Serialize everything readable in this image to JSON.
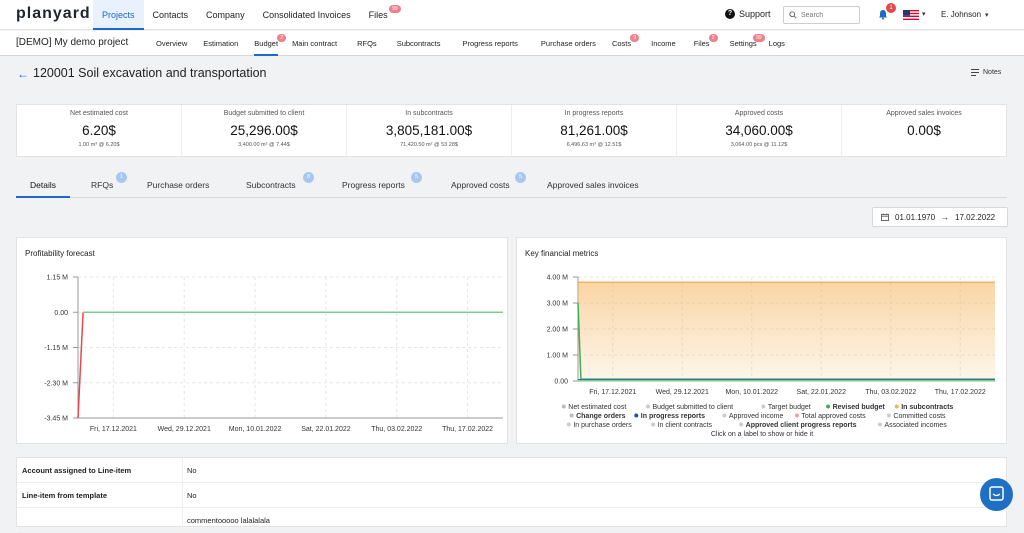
{
  "brand": "planyard",
  "topnav": [
    {
      "label": "Projects",
      "active": true
    },
    {
      "label": "Contacts"
    },
    {
      "label": "Company"
    },
    {
      "label": "Consolidated Invoices"
    },
    {
      "label": "Files",
      "badge": "99"
    }
  ],
  "support_label": "Support",
  "search": {
    "placeholder": "Search",
    "value": ""
  },
  "notifications_count": "1",
  "user_name": "E. Johnson",
  "project": {
    "name": "[DEMO] My demo project"
  },
  "subnav": [
    {
      "label": "Overview"
    },
    {
      "label": "Estimation"
    },
    {
      "label": "Budget",
      "badge": "2",
      "active": true
    },
    {
      "label": "Main contract"
    },
    {
      "label": "RFQs"
    },
    {
      "label": "Subcontracts"
    },
    {
      "label": "Progress reports"
    },
    {
      "label": "Purchase orders"
    },
    {
      "label": "Costs",
      "badge": "9"
    },
    {
      "label": "Income"
    },
    {
      "label": "Files",
      "badge": "2"
    },
    {
      "label": "Settings",
      "badge": "99"
    },
    {
      "label": "Logs"
    }
  ],
  "page_title": "120001 Soil excavation and transportation",
  "notes_label": "Notes",
  "stats": [
    {
      "label": "Net estimated cost",
      "value": "6.20$",
      "sub": "1.00 m³ @ 6.20$"
    },
    {
      "label": "Budget submitted to client",
      "value": "25,296.00$",
      "sub": "3,400.00 m² @ 7.44$"
    },
    {
      "label": "In subcontracts",
      "value": "3,805,181.00$",
      "sub": "71,420.50 m² @ 53.28$"
    },
    {
      "label": "In progress reports",
      "value": "81,261.00$",
      "sub": "6,496.63 m³ @ 12.51$"
    },
    {
      "label": "Approved costs",
      "value": "34,060.00$",
      "sub": "3,064.00 pcs @ 11.12$"
    },
    {
      "label": "Approved sales invoices",
      "value": "0.00$",
      "sub": ""
    }
  ],
  "tabs": [
    {
      "label": "Details",
      "active": true
    },
    {
      "label": "RFQs",
      "badge": "1"
    },
    {
      "label": "Purchase orders"
    },
    {
      "label": "Subcontracts",
      "badge": "8"
    },
    {
      "label": "Progress reports",
      "badge": "5"
    },
    {
      "label": "Approved costs",
      "badge": "5"
    },
    {
      "label": "Approved sales invoices"
    }
  ],
  "date_range": {
    "from": "01.01.1970",
    "to": "17.02.2022",
    "separator": "→"
  },
  "colors": {
    "accent": "#1e66d0",
    "badge": "#ef7f8b",
    "tab_badge": "#a9c6f2",
    "orange": "#f4b35a",
    "green": "#7ccf8a",
    "red": "#e5484d"
  },
  "chart_data": [
    {
      "type": "line",
      "title": "Profitability forecast",
      "x": [
        "Fri, 17.12.2021",
        "Wed, 29.12.2021",
        "Mon, 10.01.2022",
        "Sat, 22.01.2022",
        "Thu, 03.02.2022",
        "Thu, 17.02.2022"
      ],
      "yticks": [
        "1.15 M",
        "0.00",
        "-1.15 M",
        "-2.30 M",
        "-3.45 M"
      ],
      "ylim": [
        -3.45,
        1.15
      ],
      "grid": true,
      "series": [
        {
          "color": "#e5484d",
          "points": [
            [
              0,
              -3.45
            ],
            [
              0.012,
              0
            ]
          ]
        },
        {
          "color": "#7ccf8a",
          "points": [
            [
              0.012,
              0
            ],
            [
              1,
              0
            ]
          ]
        }
      ]
    },
    {
      "type": "area",
      "title": "Key financial metrics",
      "x": [
        "Fri, 17.12.2021",
        "Wed, 29.12.2021",
        "Mon, 10.01.2022",
        "Sat, 22.01.2022",
        "Thu, 03.02.2022",
        "Thu, 17.02.2022"
      ],
      "yticks": [
        "4.00 M",
        "3.00 M",
        "2.00 M",
        "1.00 M",
        "0.00"
      ],
      "ylim": [
        0,
        4
      ],
      "grid": true,
      "series": [
        {
          "name": "In subcontracts",
          "color": "#f4b35a",
          "area": true,
          "points": [
            [
              0,
              3.8
            ],
            [
              1,
              3.8
            ]
          ]
        },
        {
          "name": "Revised budget",
          "color": "#3fae5b",
          "points": [
            [
              0,
              3.0
            ],
            [
              0.007,
              0.07
            ],
            [
              1,
              0.07
            ]
          ]
        },
        {
          "name": "In progress reports",
          "color": "#1f4fa8",
          "points": [
            [
              0,
              0.05
            ],
            [
              1,
              0.05
            ]
          ]
        },
        {
          "name": "Target budget",
          "color": "#7ccf8a",
          "points": [
            [
              0,
              0.02
            ],
            [
              1,
              0.02
            ]
          ]
        }
      ],
      "legend": {
        "rows": [
          [
            {
              "label": "Net estimated cost",
              "color": "#bbbbbb",
              "bold": false
            },
            {
              "label": "Budget submitted to client",
              "color": "#cccccc",
              "bold": false
            },
            {
              "label": "Target budget",
              "color": "#cccccc",
              "bold": false
            },
            {
              "label": "Revised budget",
              "color": "#3fae5b",
              "bold": true
            },
            {
              "label": "In subcontracts",
              "color": "#f4b35a",
              "bold": true
            }
          ],
          [
            {
              "label": "Change orders",
              "color": "#bbbbbb",
              "bold": true
            },
            {
              "label": "In progress reports",
              "color": "#1f4fa8",
              "bold": true
            },
            {
              "label": "Approved income",
              "color": "#cccccc",
              "bold": false
            },
            {
              "label": "Total approved costs",
              "color": "#f0a0a0",
              "bold": false
            },
            {
              "label": "Committed costs",
              "color": "#cccccc",
              "bold": false
            }
          ],
          [
            {
              "label": "In purchase orders",
              "color": "#cccccc",
              "bold": false
            },
            {
              "label": "In client contracts",
              "color": "#cccccc",
              "bold": false
            },
            {
              "label": "Approved client progress reports",
              "color": "#cccccc",
              "bold": true
            },
            {
              "label": "Associated incomes",
              "color": "#cccccc",
              "bold": false
            }
          ]
        ],
        "hint": "Click on a label to show or hide it"
      }
    }
  ],
  "attributes": [
    {
      "key": "Account assigned to Line-item",
      "value": "No"
    },
    {
      "key": "Line-item from template",
      "value": "No"
    },
    {
      "key": "",
      "value": "commentooooo lalalalala"
    }
  ]
}
